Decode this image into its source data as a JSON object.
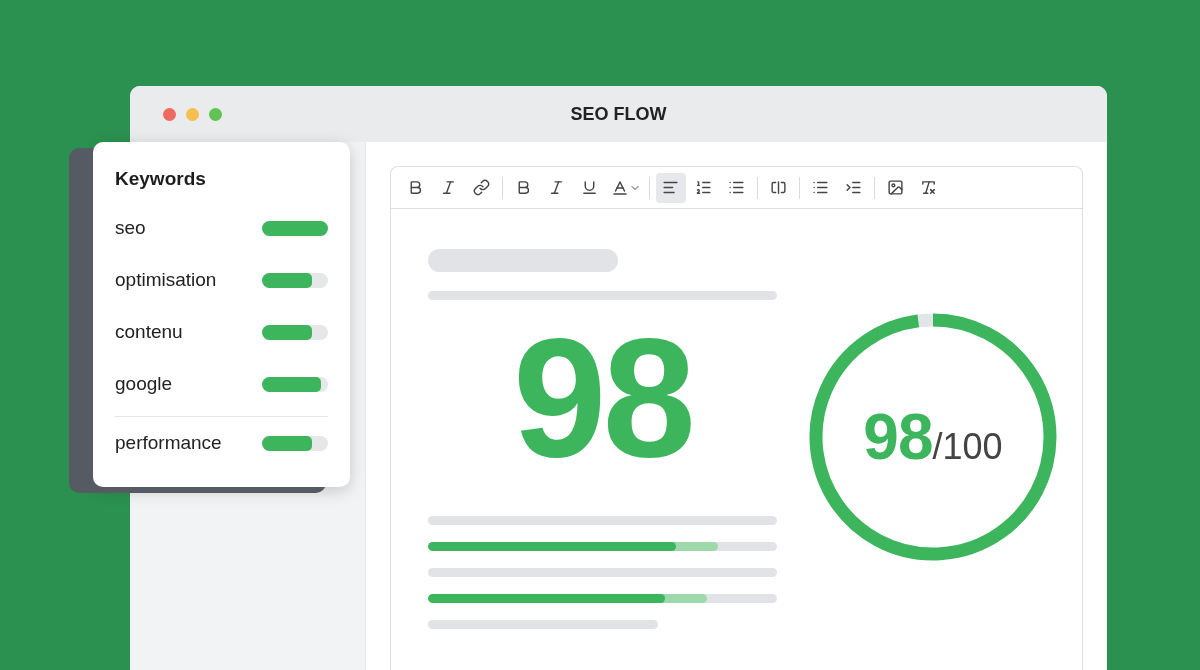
{
  "window": {
    "title": "SEO FLOW"
  },
  "keywords": {
    "title": "Keywords",
    "items": [
      {
        "term": "seo",
        "level": 1.0,
        "divider_before": false
      },
      {
        "term": "optimisation",
        "level": 0.76,
        "divider_before": false
      },
      {
        "term": "contenu",
        "level": 0.76,
        "divider_before": false
      },
      {
        "term": "google",
        "level": 0.9,
        "divider_before": false
      },
      {
        "term": "performance",
        "level": 0.76,
        "divider_before": true
      }
    ]
  },
  "toolbar": {
    "groups": [
      [
        {
          "kind": "bold",
          "selected": false
        },
        {
          "kind": "italic",
          "selected": false
        },
        {
          "kind": "link",
          "selected": false
        }
      ],
      [
        {
          "kind": "bold",
          "selected": false
        },
        {
          "kind": "italic",
          "selected": false
        },
        {
          "kind": "underline",
          "selected": false
        },
        {
          "kind": "color",
          "selected": false
        }
      ],
      [
        {
          "kind": "align-left",
          "selected": true
        },
        {
          "kind": "ordered-list",
          "selected": false
        },
        {
          "kind": "bullet-list",
          "selected": false
        }
      ],
      [
        {
          "kind": "embed",
          "selected": false
        }
      ],
      [
        {
          "kind": "dotted-list",
          "selected": false
        },
        {
          "kind": "indent",
          "selected": false
        }
      ],
      [
        {
          "kind": "image",
          "selected": false
        },
        {
          "kind": "clear-format",
          "selected": false
        }
      ]
    ]
  },
  "score": {
    "big_value": "98",
    "ring_value": "98",
    "ring_total": "/100"
  },
  "content_lines": [
    {
      "kind": "bar"
    },
    {
      "kind": "progress",
      "level": 0.71
    },
    {
      "kind": "bar"
    },
    {
      "kind": "progress",
      "level": 0.68
    },
    {
      "kind": "short"
    }
  ]
}
